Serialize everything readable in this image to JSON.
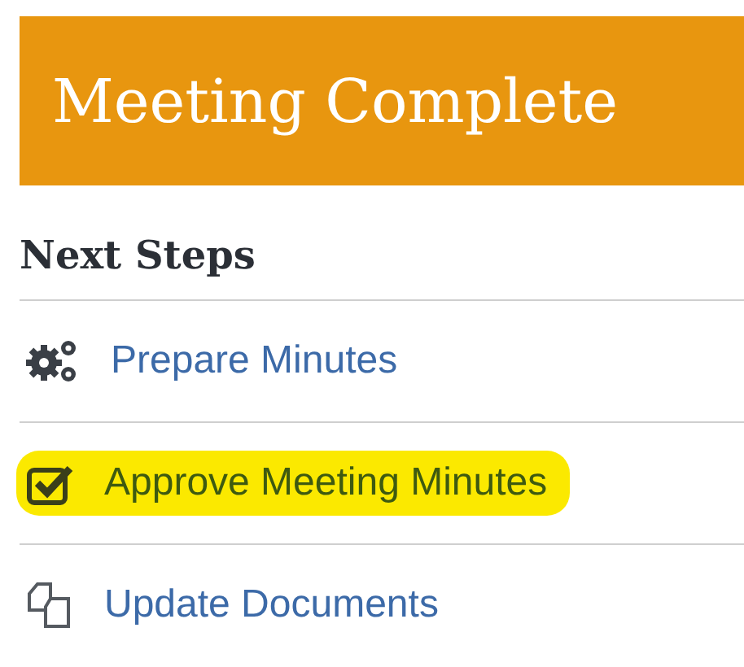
{
  "banner": {
    "title": "Meeting Complete"
  },
  "section": {
    "heading": "Next Steps"
  },
  "steps": [
    {
      "kind": "gears",
      "label": "Prepare Minutes",
      "highlighted": false
    },
    {
      "kind": "checkbox",
      "label": "Approve Meeting Minutes",
      "highlighted": true
    },
    {
      "kind": "documents",
      "label": "Update Documents",
      "highlighted": false
    }
  ]
}
